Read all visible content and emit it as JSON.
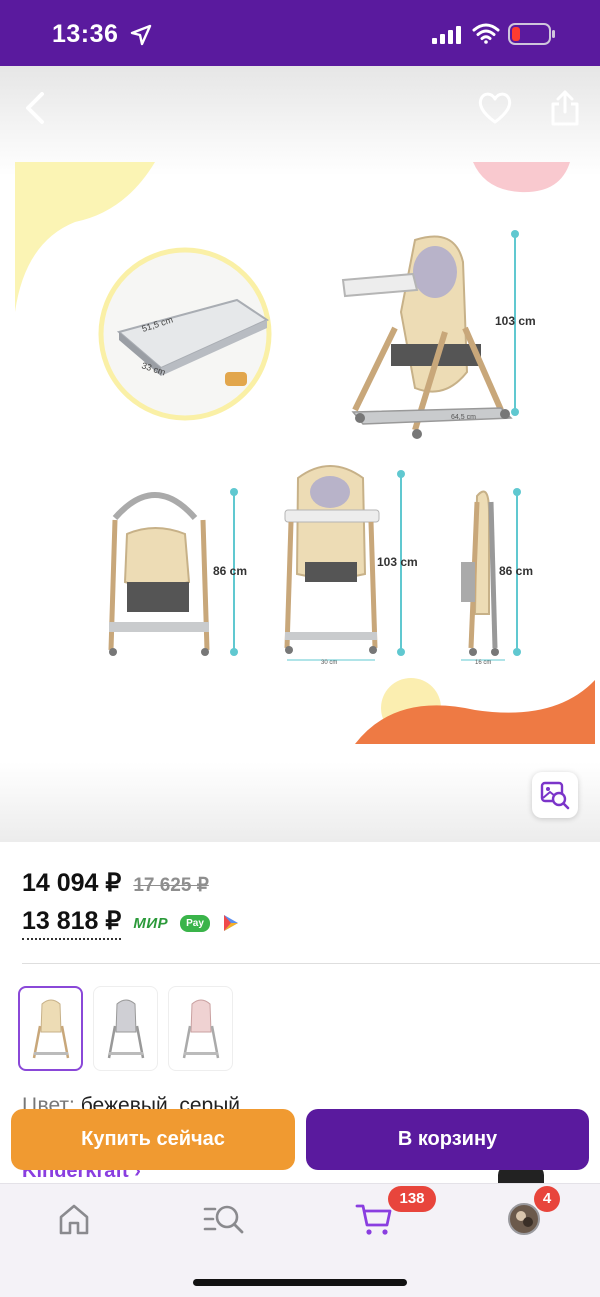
{
  "status_bar": {
    "time": "13:36",
    "icons": [
      "location-arrow-icon",
      "signal-icon",
      "wifi-icon",
      "battery-low-icon"
    ]
  },
  "gallery": {
    "nav_icons": [
      "back-arrow-icon",
      "heart-icon",
      "share-icon"
    ],
    "dimensions": {
      "tray_width": "51,5 cm",
      "tray_depth": "33 cm",
      "full_height": "103 cm",
      "base_width": "64,5 cm",
      "low_height": "86 cm",
      "front_height": "103 cm",
      "front_width": "30 cm",
      "side_height": "86 cm",
      "side_depth": "16 cm"
    },
    "visual_search_icon": "image-search-icon"
  },
  "price": {
    "current": "14 094 ₽",
    "old": "17 625 ₽",
    "card_price": "13 818 ₽",
    "payment_logos": [
      "МИР",
      "Pay"
    ]
  },
  "variants": [
    {
      "name": "beige",
      "selected": true
    },
    {
      "name": "grey",
      "selected": false
    },
    {
      "name": "pink",
      "selected": false
    }
  ],
  "color": {
    "label": "Цвет:",
    "value": "бежевый, серый"
  },
  "brand": {
    "label": "Kinderkraft ›"
  },
  "actions": {
    "buy_now": "Купить сейчас",
    "add_to_cart": "В корзину"
  },
  "tab_bar": {
    "items": [
      "home-icon",
      "catalog-search-icon",
      "cart-icon",
      "profile-avatar"
    ],
    "cart_badge": "138",
    "profile_badge": "4"
  },
  "colors": {
    "brand_purple": "#5a1a9e",
    "accent_orange": "#f09a31",
    "badge_red": "#e8453c",
    "link_purple": "#8a3ee0"
  }
}
